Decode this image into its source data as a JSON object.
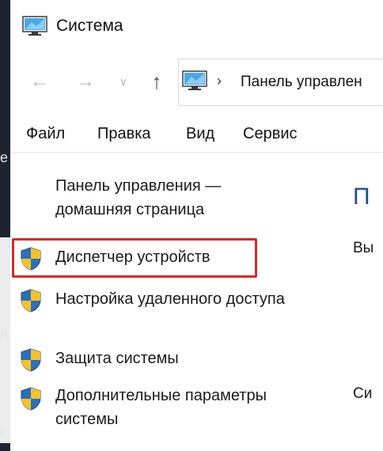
{
  "window": {
    "title": "Система"
  },
  "address_bar": {
    "crumb": "Панель управлен"
  },
  "menu": {
    "file": "Файл",
    "edit": "Правка",
    "view": "Вид",
    "service": "Сервис"
  },
  "left_pane": {
    "home_link": "Панель управления — домашняя страница",
    "tasks": [
      {
        "label": "Диспетчер устройств"
      },
      {
        "label": "Настройка удаленного доступа"
      },
      {
        "label": "Защита системы"
      },
      {
        "label": "Дополнительные параметры системы"
      }
    ]
  },
  "content_fragments": {
    "heading": "П",
    "line1": "Вы",
    "line2": "Си"
  },
  "desktop_fragments": {
    "a": "e",
    "b": "д",
    "c": "c"
  },
  "colors": {
    "highlight": "#d12b2b",
    "shield_blue": "#2f6fb6",
    "shield_yellow": "#f2c230",
    "heading_blue": "#1e4f8c"
  },
  "icons": {
    "app": "monitor-icon",
    "task": "uac-shield-icon"
  }
}
